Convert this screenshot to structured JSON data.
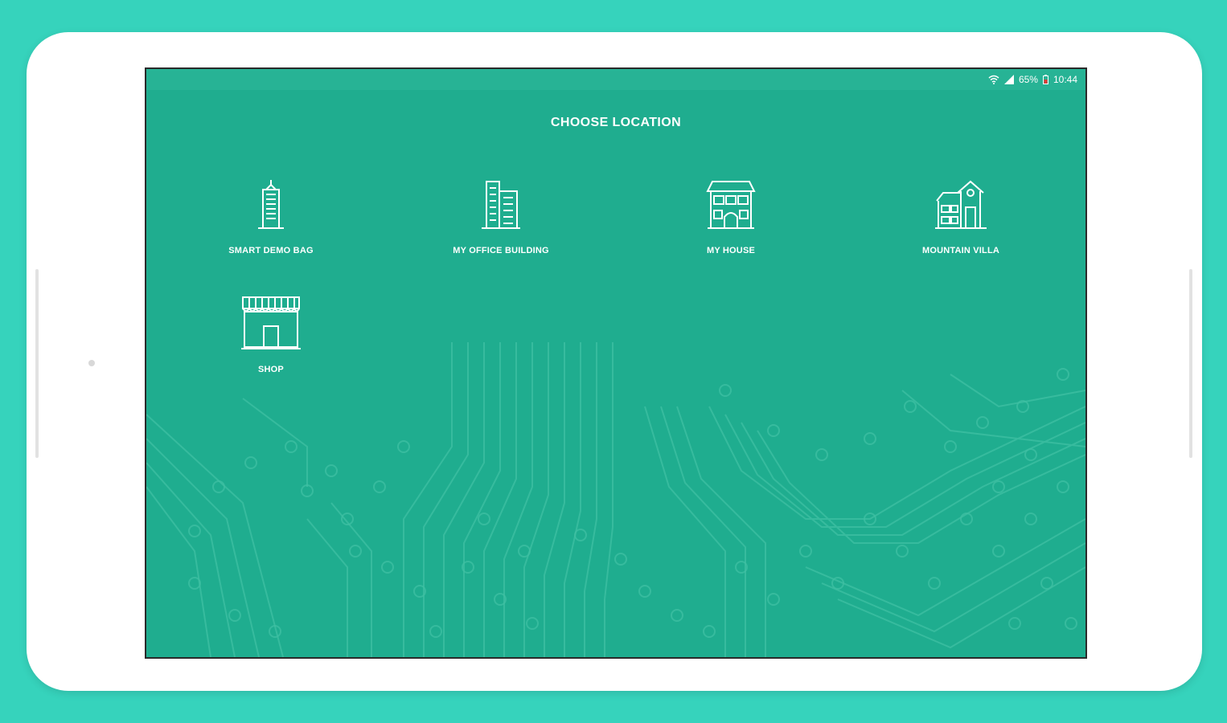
{
  "status_bar": {
    "battery": "65%",
    "time": "10:44",
    "icons": [
      "wifi-icon",
      "signal-icon",
      "battery-icon"
    ]
  },
  "screen": {
    "title": "CHOOSE LOCATION",
    "background": "circuit-board pattern",
    "locations": [
      {
        "label": "SMART DEMO BAG",
        "icon": "skyscraper-icon"
      },
      {
        "label": "MY OFFICE BUILDING",
        "icon": "office-building-icon"
      },
      {
        "label": "MY HOUSE",
        "icon": "house-icon"
      },
      {
        "label": "MOUNTAIN VILLA",
        "icon": "villa-icon"
      },
      {
        "label": "SHOP",
        "icon": "shop-icon"
      }
    ]
  },
  "colors": {
    "backdrop": "#36d3bc",
    "screen": "#1fad8f",
    "status_bar": "#27b395",
    "text": "#ffffff"
  }
}
